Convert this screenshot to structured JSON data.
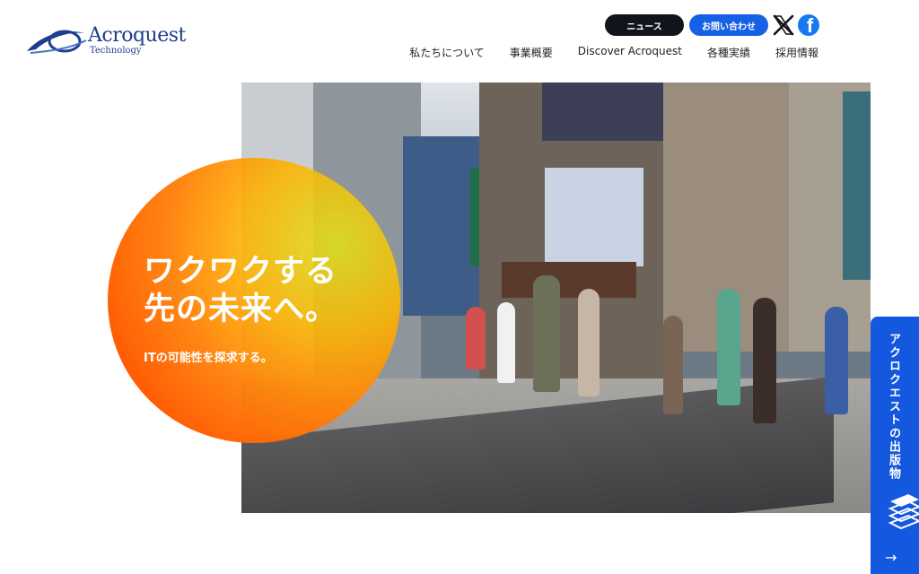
{
  "header": {
    "logo_name": "Acroquest",
    "logo_sub": "Technology",
    "news_label": "ニュース",
    "contact_label": "お問い合わせ",
    "social": [
      "x-icon",
      "facebook-icon"
    ]
  },
  "nav": {
    "items": [
      {
        "label": "私たちについて"
      },
      {
        "label": "事業概要"
      },
      {
        "label": "Discover Acroquest"
      },
      {
        "label": "各種実績"
      },
      {
        "label": "採用情報"
      }
    ]
  },
  "hero": {
    "title_line1": "ワクワクする",
    "title_line2": "先の未来へ。",
    "subtitle": "ITの可能性を探求する。"
  },
  "sidetab": {
    "label": "アクロクエストの出版物"
  },
  "colors": {
    "brand": "#1d3d8f",
    "contact_button": "#1660e6",
    "news_button": "#12141c",
    "sidetab": "#1558e0",
    "circle_orange": "#f55f0f",
    "circle_yellow": "#e1e128"
  }
}
